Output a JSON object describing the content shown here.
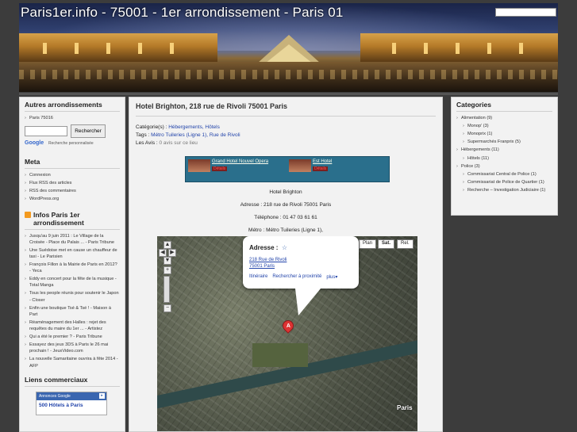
{
  "header": {
    "site_title": "Paris1er.info - 75001 - 1er arrondissement - Paris 01",
    "search_placeholder": ""
  },
  "left_sidebar": {
    "arrondissements": {
      "title": "Autres arrondissements",
      "items": [
        "Paris 75016"
      ]
    },
    "google_search": {
      "button_label": "Rechercher",
      "logo_text": "Google",
      "custom_text": "Recherche personnalisée"
    },
    "meta": {
      "title": "Meta",
      "items": [
        "Connexion",
        "Flux RSS des articles",
        "RSS des commentaires",
        "WordPress.org"
      ]
    },
    "infos": {
      "title": "Infos Paris 1er arrondissement",
      "items": [
        "Jusqu'au 9 juin 2011 : Le Village de la Croisée - Place du Palais ... - Paris Tribune",
        "Une Suédoise met en cause un chauffeur de taxi - Le Parisien",
        "François Fillon à la Mairie de Paris en 2012? - Yeca",
        "Eddy en concert pour la fête de la musique - Total Manga",
        "Tous les people réunis pour soutenir le Japon - Closer",
        "Enfin une boutique Tsé & Tsé ! - Maison à Part",
        "Réaménagement des Halles : rejet des requêtes du maire du 1er ... - Artistez",
        "Qui a été le premier ? - Paris Tribune",
        "Essayez des jeux 3DS à Paris le 26 mai prochain ! - JeuxVideo.com",
        "La nouvelle Samaritaine ouvrira à fête 2014 - AFP"
      ]
    },
    "liens": {
      "title": "Liens commerciaux",
      "ad_header": "Annonces Google",
      "ad_link": "500 Hôtels à Paris"
    }
  },
  "main": {
    "title": "Hotel Brighton, 218 rue de Rivoli 75001 Paris",
    "categories_label": "Catégorie(s) :",
    "categories": "Hébergements, Hôtels",
    "tags_label": "Tags :",
    "tags": "Métro Tuileries (Ligne 1), Rue de Rivoli",
    "avis_label": "Les Avis :",
    "avis": "0 avis sur ce lieu",
    "hotel_ads": [
      {
        "name": "Grand Hotel Nouvel Opera",
        "tag": "Détails"
      },
      {
        "name": "Est Hotel",
        "tag": "Détails"
      }
    ],
    "info_name": "Hotel Brighton",
    "info_address": "Adresse : 218 rue de Rivoli 75001 Paris",
    "info_phone": "Téléphone : 01 47 03 61 61",
    "info_metro": "Métro : Métro Tuileries (Ligne 1),",
    "map": {
      "popup_title": "Adresse :",
      "popup_addr_line1": "218 Rue de Rivoli",
      "popup_addr_line2": "75001 Paris",
      "popup_links": [
        "Itinéraire",
        "Rechercher à proximité",
        "plus▾"
      ],
      "types": [
        "Plan",
        "Sat.",
        "Rel."
      ],
      "marker_label": "A",
      "labels": [
        "Paris"
      ]
    }
  },
  "right_sidebar": {
    "title": "Categories",
    "items": [
      {
        "label": "Alimentation (9)",
        "level": 0
      },
      {
        "label": "Monop' (3)",
        "level": 1
      },
      {
        "label": "Monoprix (1)",
        "level": 1
      },
      {
        "label": "Supermarchés Franprix (5)",
        "level": 1
      },
      {
        "label": "Hébergements (11)",
        "level": 0
      },
      {
        "label": "Hôtels (11)",
        "level": 1
      },
      {
        "label": "Police (3)",
        "level": 0
      },
      {
        "label": "Commissariat Central de Police (1)",
        "level": 1
      },
      {
        "label": "Commissariat de Police de Quartier (1)",
        "level": 1
      },
      {
        "label": "Recherche – Investigation Judiciaire (1)",
        "level": 1
      }
    ]
  }
}
